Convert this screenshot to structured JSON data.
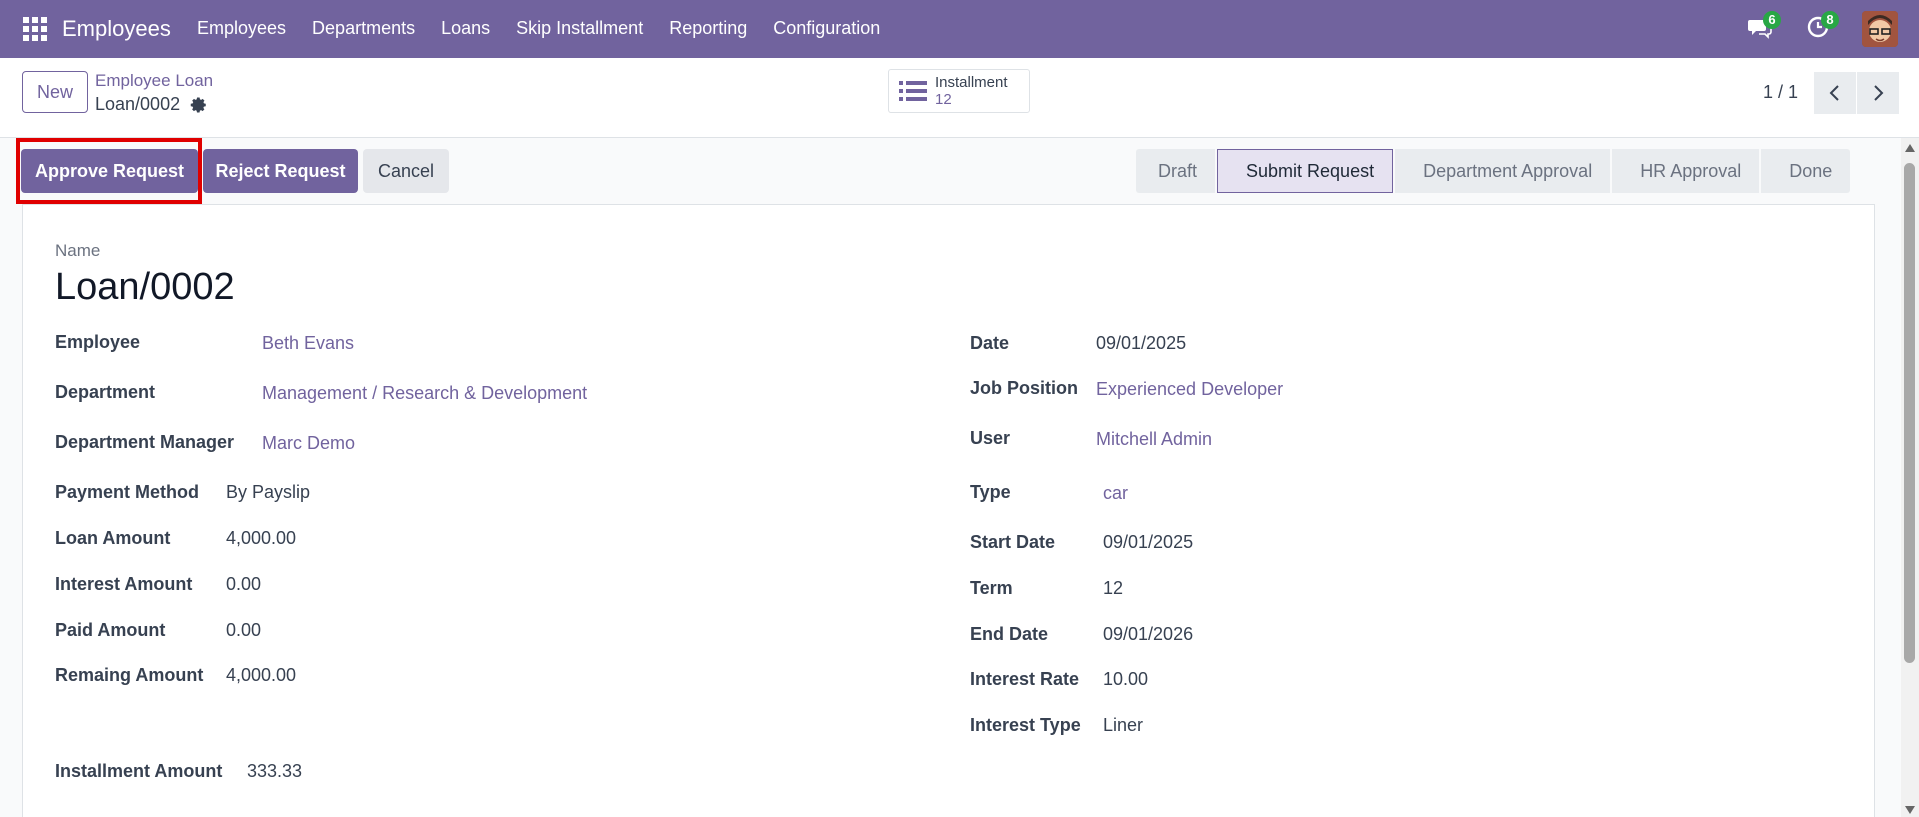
{
  "navbar": {
    "brand": "Employees",
    "menu": [
      "Employees",
      "Departments",
      "Loans",
      "Skip Installment",
      "Reporting",
      "Configuration"
    ],
    "chat_count": "6",
    "activity_count": "8"
  },
  "control": {
    "new_label": "New",
    "breadcrumb_parent": "Employee Loan",
    "breadcrumb_current": "Loan/0002",
    "smart_button": {
      "label": "Installment",
      "count": "12"
    },
    "pager": "1 / 1"
  },
  "actions": {
    "approve": "Approve Request",
    "reject": "Reject Request",
    "cancel": "Cancel"
  },
  "statusbar": {
    "stages": [
      "Draft",
      "Submit Request",
      "Department Approval",
      "HR Approval",
      "Done"
    ],
    "active": "Submit Request"
  },
  "form": {
    "name_label": "Name",
    "name_value": "Loan/0002",
    "left": {
      "employee_label": "Employee",
      "employee": "Beth Evans",
      "department_label": "Department",
      "department": "Management / Research & Development",
      "manager_label": "Department Manager",
      "manager": "Marc Demo",
      "payment_method_label": "Payment Method",
      "payment_method": "By Payslip",
      "loan_amount_label": "Loan Amount",
      "loan_amount": "4,000.00",
      "interest_amount_label": "Interest Amount",
      "interest_amount": "0.00",
      "paid_amount_label": "Paid Amount",
      "paid_amount": "0.00",
      "remaining_amount_label": "Remaing Amount",
      "remaining_amount": "4,000.00",
      "installment_amount_label": "Installment Amount",
      "installment_amount": "333.33"
    },
    "right": {
      "date_label": "Date",
      "date": "09/01/2025",
      "job_position_label": "Job Position",
      "job_position": "Experienced Developer",
      "user_label": "User",
      "user": "Mitchell Admin",
      "type_label": "Type",
      "type": "car",
      "start_date_label": "Start Date",
      "start_date": "09/01/2025",
      "term_label": "Term",
      "term": "12",
      "end_date_label": "End Date",
      "end_date": "09/01/2026",
      "interest_rate_label": "Interest Rate",
      "interest_rate": "10.00",
      "interest_type_label": "Interest Type",
      "interest_type": "Liner"
    }
  },
  "colors": {
    "brand": "#71639e",
    "highlight": "#e00000",
    "badge": "#28a745"
  }
}
